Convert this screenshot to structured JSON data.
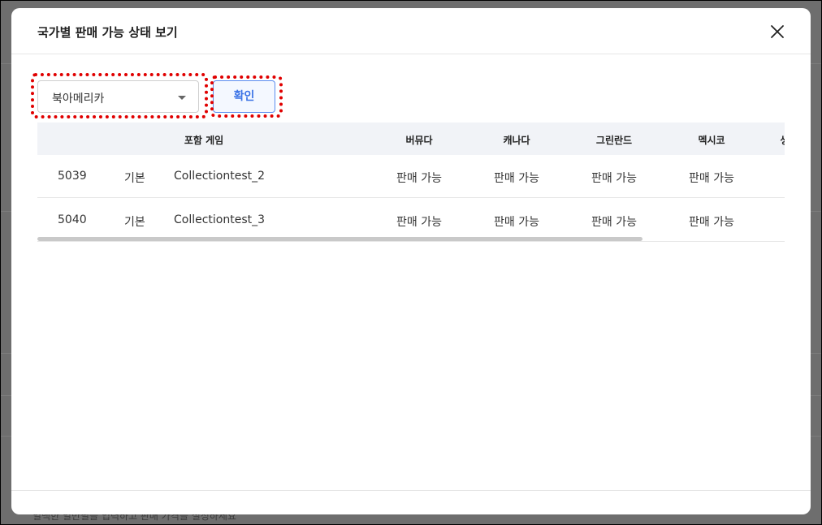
{
  "background": {
    "footer_text": "일백한 일반필을 입력하고 판매 가격을 설정하세요"
  },
  "modal": {
    "title": "국가별 판매 가능 상태 보기",
    "close_icon": "close-icon"
  },
  "controls": {
    "region_select": {
      "value": "북아메리카",
      "icon": "caret-down-icon"
    },
    "confirm_label": "확인"
  },
  "table": {
    "headers": [
      "포함 게임",
      "버뮤다",
      "캐나다",
      "그린란드",
      "멕시코",
      "생"
    ],
    "rows": [
      {
        "id": "5039",
        "type": "기본",
        "name": "Collectiontest_2",
        "statuses": [
          "판매 가능",
          "판매 가능",
          "판매 가능",
          "판매 가능"
        ]
      },
      {
        "id": "5040",
        "type": "기본",
        "name": "Collectiontest_3",
        "statuses": [
          "판매 가능",
          "판매 가능",
          "판매 가능",
          "판매 가능"
        ]
      }
    ],
    "scroll_fraction": 0.81
  },
  "colors": {
    "highlight": "#e00000",
    "accent": "#3b73e6",
    "overlay": "#6e6e6e"
  }
}
